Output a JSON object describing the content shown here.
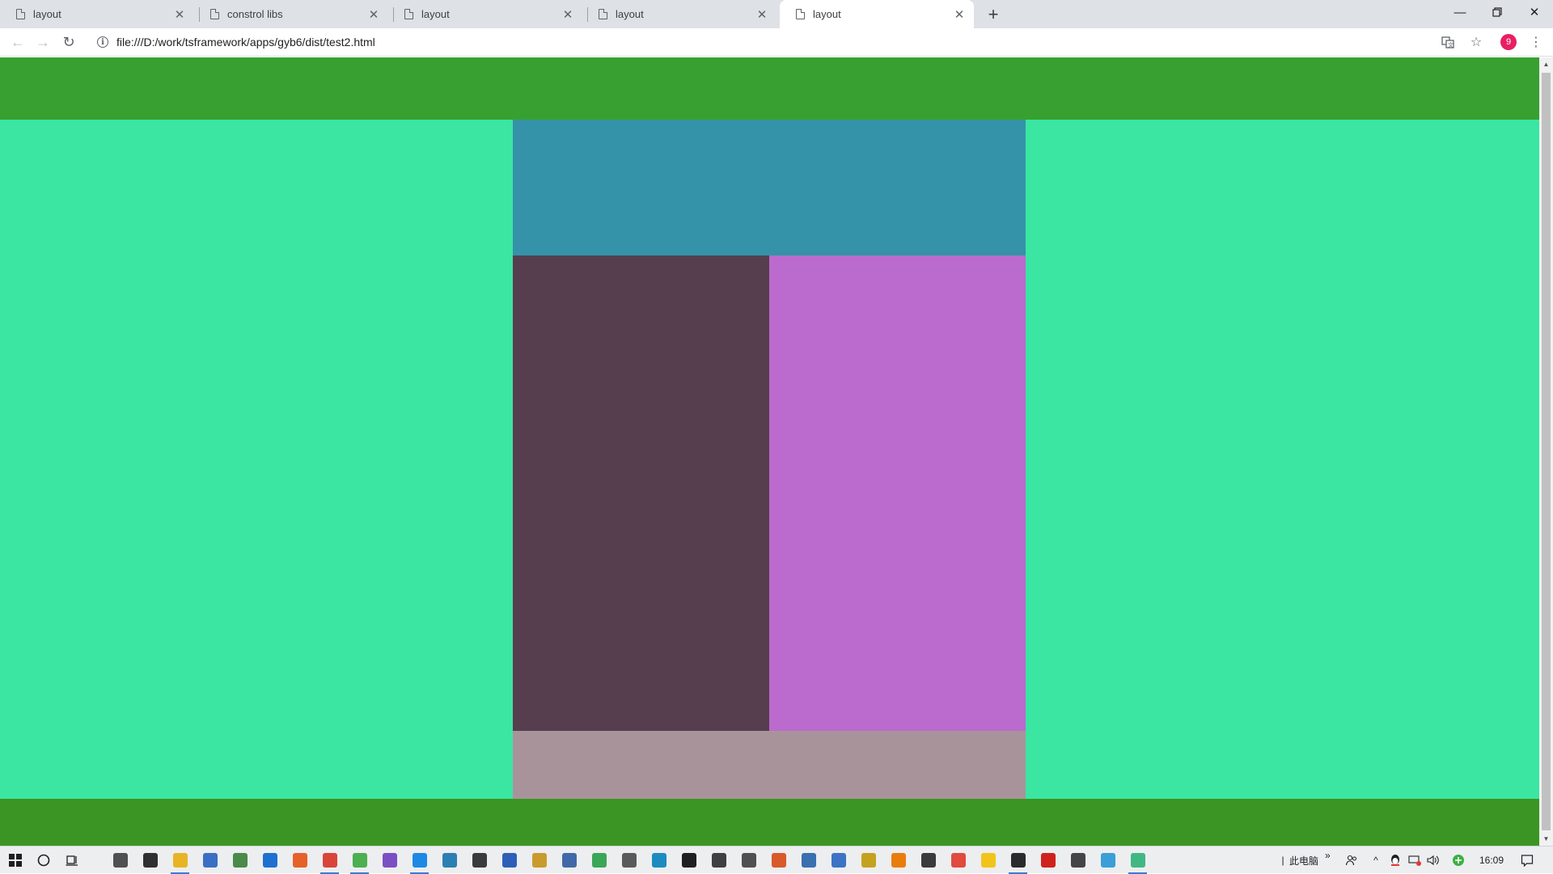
{
  "browser": {
    "tabs": [
      {
        "title": "layout",
        "active": false
      },
      {
        "title": "constrol libs",
        "active": false
      },
      {
        "title": "layout",
        "active": false
      },
      {
        "title": "layout",
        "active": false
      },
      {
        "title": "layout",
        "active": true
      }
    ],
    "new_tab_label": "+",
    "address": "file:///D:/work/tsframework/apps/gyb6/dist/test2.html",
    "profile_badge": "9"
  },
  "page": {
    "background_color": "#3ae6a1",
    "header_color": "#37a031",
    "footer_color": "#3b9524",
    "blocks": {
      "top_color": "#3493a8",
      "left_color": "#563e4e",
      "right_color": "#bb6bcd",
      "bottom_color": "#a9939b"
    }
  },
  "taskbar": {
    "apps": [
      {
        "name": "store-icon",
        "color": "#505050",
        "running": false
      },
      {
        "name": "mail-icon",
        "color": "#303030",
        "running": false
      },
      {
        "name": "file-explorer-icon",
        "color": "#e8b425",
        "running": true
      },
      {
        "name": "remote-desktop-icon",
        "color": "#3a6fc4",
        "running": false
      },
      {
        "name": "tool-icon",
        "color": "#4a8a4a",
        "running": false
      },
      {
        "name": "edge-icon",
        "color": "#1f6fd1",
        "running": false
      },
      {
        "name": "firefox-icon",
        "color": "#e5622a",
        "running": false
      },
      {
        "name": "chrome-icon",
        "color": "#d9453a",
        "running": true
      },
      {
        "name": "green-app-icon",
        "color": "#4caf50",
        "running": true
      },
      {
        "name": "visual-studio-icon",
        "color": "#7b4fc4",
        "running": false
      },
      {
        "name": "vscode-icon",
        "color": "#1e88e5",
        "running": true
      },
      {
        "name": "python-icon",
        "color": "#2b7fb3",
        "running": false
      },
      {
        "name": "powershell-icon",
        "color": "#3b3b3b",
        "running": false
      },
      {
        "name": "paint-icon",
        "color": "#2d5fb8",
        "running": false
      },
      {
        "name": "package-icon",
        "color": "#c99a2e",
        "running": false
      },
      {
        "name": "network-icon",
        "color": "#4169a8",
        "running": false
      },
      {
        "name": "android-icon",
        "color": "#3aa657",
        "running": false
      },
      {
        "name": "database-icon",
        "color": "#5a5a5a",
        "running": false
      },
      {
        "name": "sync-icon",
        "color": "#1d8bbf",
        "running": false
      },
      {
        "name": "media-icon",
        "color": "#202020",
        "running": false
      },
      {
        "name": "terminal-icon",
        "color": "#404040",
        "running": false
      },
      {
        "name": "keyboard-icon",
        "color": "#505050",
        "running": false
      },
      {
        "name": "java-icon",
        "color": "#d95a2b",
        "running": false
      },
      {
        "name": "monitor-icon",
        "color": "#3a6fb0",
        "running": false
      },
      {
        "name": "design-icon",
        "color": "#3c73c4",
        "running": false
      },
      {
        "name": "notes-icon",
        "color": "#c4a21e",
        "running": false
      },
      {
        "name": "blender-icon",
        "color": "#e87d0d",
        "running": false
      },
      {
        "name": "sphere-icon",
        "color": "#3b3b3b",
        "running": false
      },
      {
        "name": "blocks-icon",
        "color": "#e04a3f",
        "running": false
      },
      {
        "name": "sticky-icon",
        "color": "#f2c31b",
        "running": false
      },
      {
        "name": "screen-icon",
        "color": "#2b2b2b",
        "running": true
      },
      {
        "name": "pdf-icon",
        "color": "#d0221c",
        "running": false
      },
      {
        "name": "calculator-icon",
        "color": "#454545",
        "running": false
      },
      {
        "name": "notebook-icon",
        "color": "#3b9ed6",
        "running": false
      },
      {
        "name": "vue-icon",
        "color": "#41b883",
        "running": true
      }
    ],
    "tray_label": "此电脑",
    "tray_chevron": "»",
    "clock": "16:09"
  }
}
